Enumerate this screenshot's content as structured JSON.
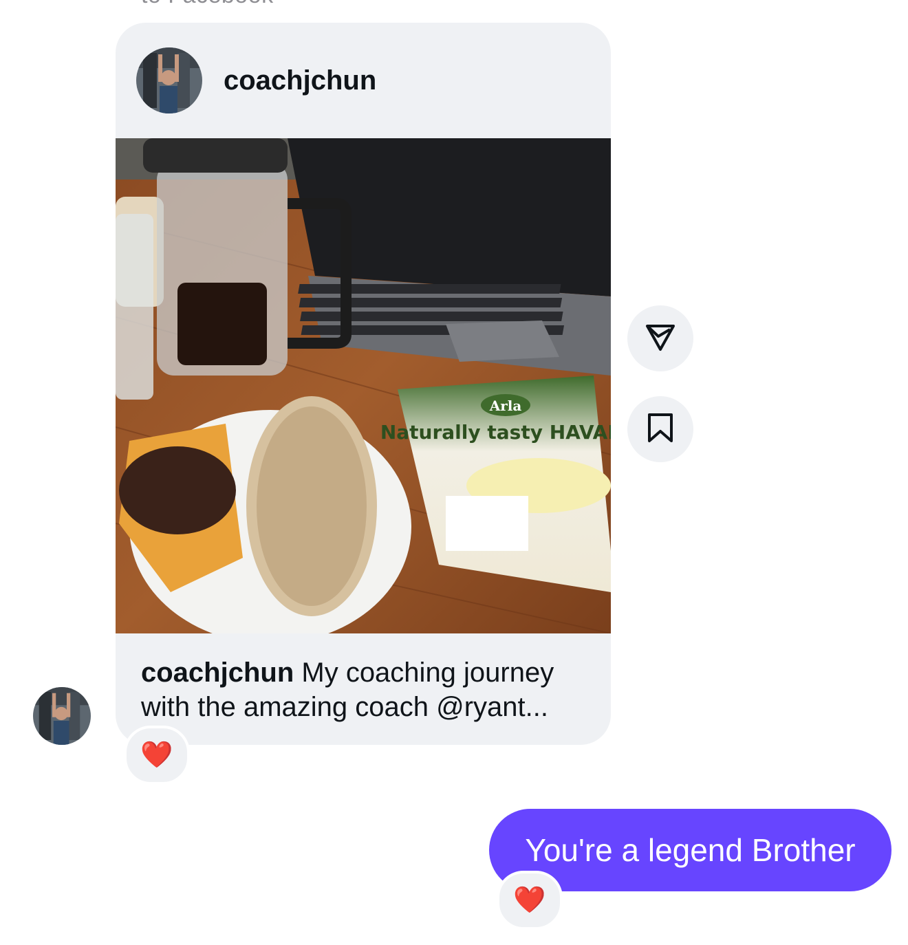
{
  "header_clip": "to Facebook",
  "shared_post": {
    "username": "coachjchun",
    "caption_user": "coachjchun",
    "caption_text": " My coaching journey with the amazing coach @ryant...",
    "image_label": "Naturally tasty HAVARTI",
    "brand": "Arla",
    "reaction": "❤️"
  },
  "actions": {
    "share_icon": "send-icon",
    "save_icon": "bookmark-icon"
  },
  "outgoing_message": {
    "text": "You're a legend Brother",
    "reaction": "❤️"
  },
  "colors": {
    "bubble_out": "#6745ff",
    "card_bg": "#eff1f4",
    "text": "#0f1419"
  }
}
